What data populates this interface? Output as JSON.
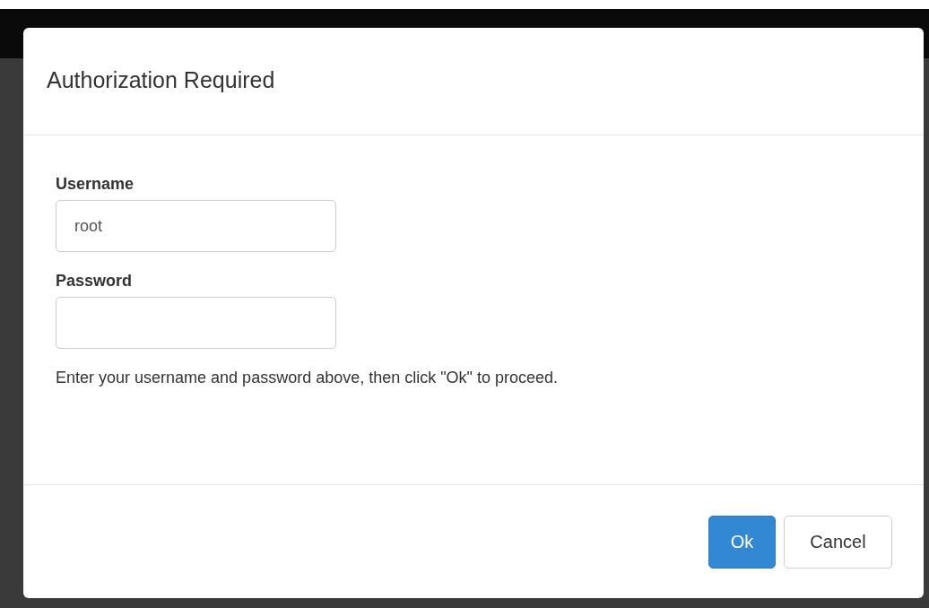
{
  "dialog": {
    "title": "Authorization Required",
    "fields": [
      {
        "label": "Username",
        "value": "root"
      },
      {
        "label": "Password"
      }
    ],
    "help_text": "Enter your username and password above, then click \"Ok\" to proceed.",
    "buttons": [
      {
        "label": "Ok",
        "kind": "primary"
      },
      {
        "label": "Cancel",
        "kind": "default"
      }
    ]
  }
}
